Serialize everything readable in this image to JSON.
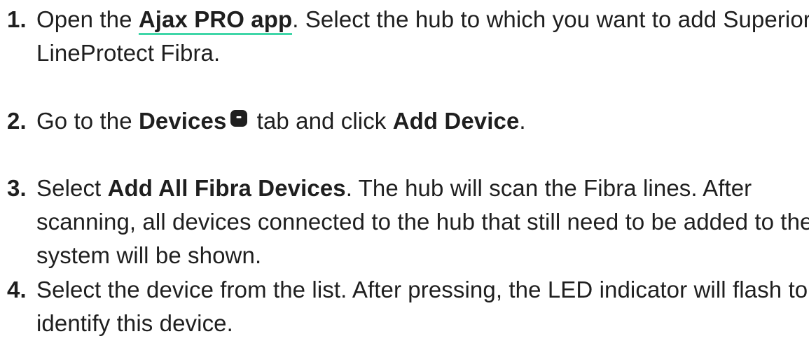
{
  "steps": [
    {
      "number": "1.",
      "text_before": "Open the ",
      "link_text": "Ajax PRO app",
      "text_after": ". Select the hub to which you want to add Superior LineProtect Fibra."
    },
    {
      "number": "2.",
      "text_before": "Go to the ",
      "bold_1": "Devices",
      "icon": "devices-tab-icon",
      "text_middle": " tab and click ",
      "bold_2": "Add Device",
      "text_after": "."
    },
    {
      "number": "3.",
      "text_before": "Select ",
      "bold_1": "Add All Fibra Devices",
      "text_after": ". The hub will scan the Fibra lines. After scanning, all devices connected to the hub that still need to be added to the system will be shown."
    },
    {
      "number": "4.",
      "text": "Select the device from the list. After pressing, the LED indicator will flash to identify this device."
    }
  ],
  "colors": {
    "text": "#1f1f1f",
    "link_underline": "#3fd6a8",
    "background": "#ffffff"
  }
}
